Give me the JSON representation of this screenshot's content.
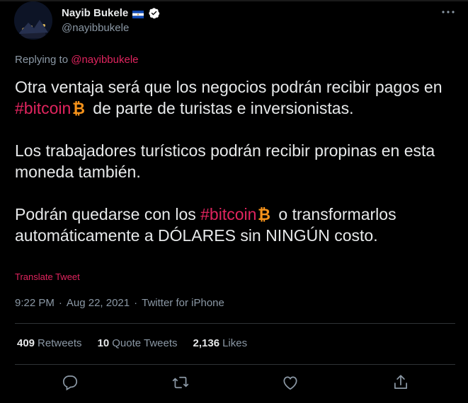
{
  "author": {
    "display_name": "Nayib Bukele",
    "handle": "@nayibbukele"
  },
  "replying": {
    "prefix": "Replying to ",
    "mention": "@nayibbukele"
  },
  "body": {
    "p1_a": "Otra ventaja será que los negocios podrán recibir pagos en ",
    "p1_hashtag": "#bitcoin",
    "p1_b": "de parte de turistas e inversionistas.",
    "p2": "Los trabajadores turísticos podrán recibir propinas en esta moneda también.",
    "p3_a": "Podrán quedarse con los ",
    "p3_hashtag": "#bitcoin",
    "p3_b": "o transformarlos automáticamente a DÓLARES sin NINGÚN costo."
  },
  "translate_label": "Translate Tweet",
  "meta": {
    "time": "9:22 PM",
    "sep1": "·",
    "date": "Aug 22, 2021",
    "sep2": "·",
    "source": "Twitter for iPhone"
  },
  "stats": {
    "retweets_num": "409",
    "retweets_label": "Retweets",
    "quotes_num": "10",
    "quotes_label": "Quote Tweets",
    "likes_num": "2,136",
    "likes_label": "Likes"
  },
  "icons": {
    "more": "more-horizontal-icon",
    "reply": "reply-icon",
    "retweet": "retweet-icon",
    "like": "heart-icon",
    "share": "share-icon",
    "verified": "verified-badge-icon",
    "flag": "el-salvador-flag-icon",
    "bitcoin": "bitcoin-emoji-icon"
  },
  "colors": {
    "accent": "#e0245e",
    "background": "#000000",
    "text_primary": "#e7e9ea",
    "text_secondary": "#8b98a5",
    "bitcoin": "#f7931a"
  }
}
